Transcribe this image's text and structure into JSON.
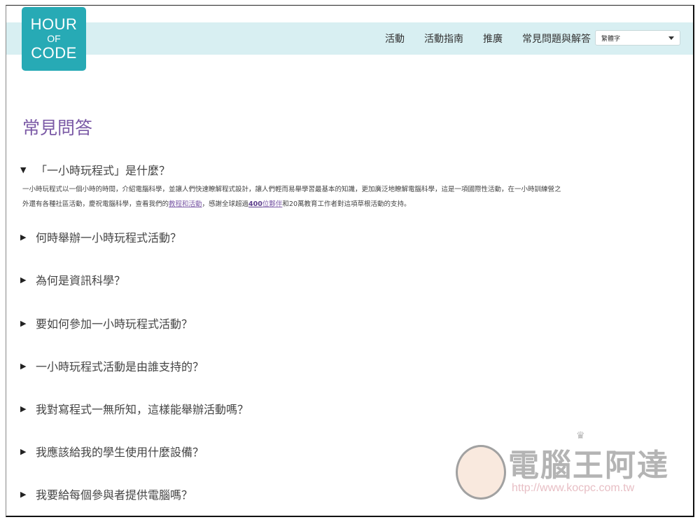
{
  "logo": {
    "line1": "HOUR",
    "line2": "OF",
    "line3": "CODE"
  },
  "nav": {
    "links": [
      "活動",
      "活動指南",
      "推廣",
      "常見問題與解答"
    ],
    "language_select": {
      "value": "繁體字"
    }
  },
  "page_title": "常見問答",
  "faq": [
    {
      "question": "「一小時玩程式」是什麼？",
      "expanded": true,
      "answer": {
        "line1": "一小時玩程式以一個小時的時間，介紹電腦科學，並讓人們快速瞭解程式設計，讓人們輕而易舉學習最基本的知識，更加廣泛地瞭解電腦科學，這是一項國際性活動，在一小時訓練營之",
        "line2_pre": "外還有各種社區活動，慶祝電腦科學，查看我們的",
        "link1": "教程和活動",
        "line2_mid": "，感謝全球超過",
        "link2_bold": "400",
        "link2_rest": "位夥伴",
        "line2_post": "和20萬教育工作者對這項草根活動的支持。"
      }
    },
    {
      "question": "何時舉辦一小時玩程式活動？",
      "expanded": false
    },
    {
      "question": "為何是資訊科學？",
      "expanded": false
    },
    {
      "question": "要如何參加一小時玩程式活動？",
      "expanded": false
    },
    {
      "question": "一小時玩程式活動是由誰支持的？",
      "expanded": false
    },
    {
      "question": "我對寫程式一無所知，這樣能舉辦活動嗎？",
      "expanded": false
    },
    {
      "question": "我應該給我的學生使用什麼設備？",
      "expanded": false
    },
    {
      "question": "我要給每個參與者提供電腦嗎？",
      "expanded": false
    }
  ],
  "icons": {
    "expanded": "▼",
    "collapsed": "▶",
    "dropdown": "caret-down"
  },
  "watermark": {
    "title": "電腦王阿達",
    "url": "http://www.kocpc.com.tw"
  },
  "colors": {
    "brand_teal": "#27aab5",
    "nav_bg": "#d8eff2",
    "title_purple": "#7b5aa6"
  }
}
